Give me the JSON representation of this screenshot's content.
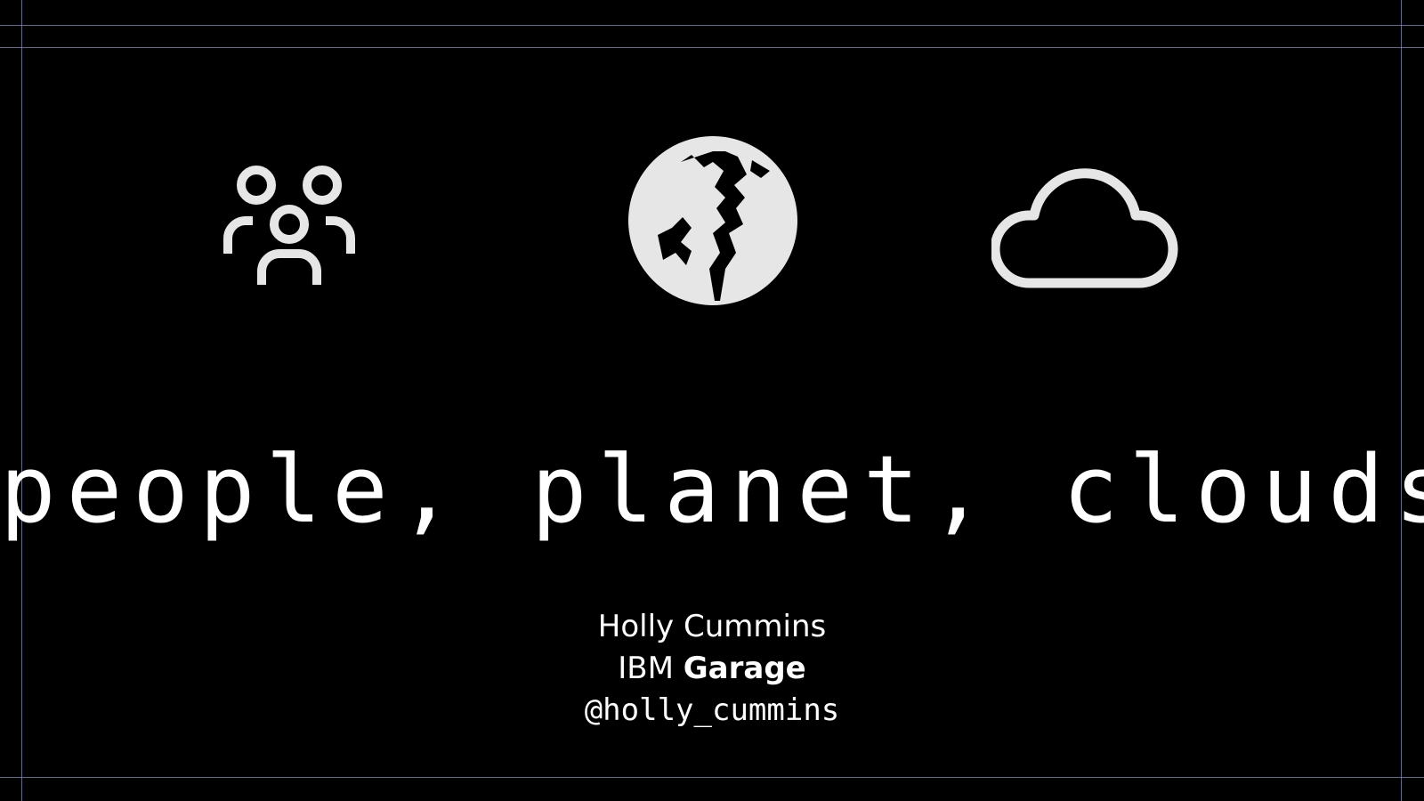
{
  "slide": {
    "title": "people, planet, clouds",
    "author": "Holly Cummins",
    "org_prefix": "IBM",
    "org_bold": "Garage",
    "handle": "@holly_cummins"
  },
  "icons": [
    "people-icon",
    "globe-icon",
    "cloud-icon"
  ],
  "colors": {
    "background": "#000000",
    "foreground": "#ffffff",
    "icon": "#e6e6e6",
    "guide_lines": "#8a8fb8"
  }
}
